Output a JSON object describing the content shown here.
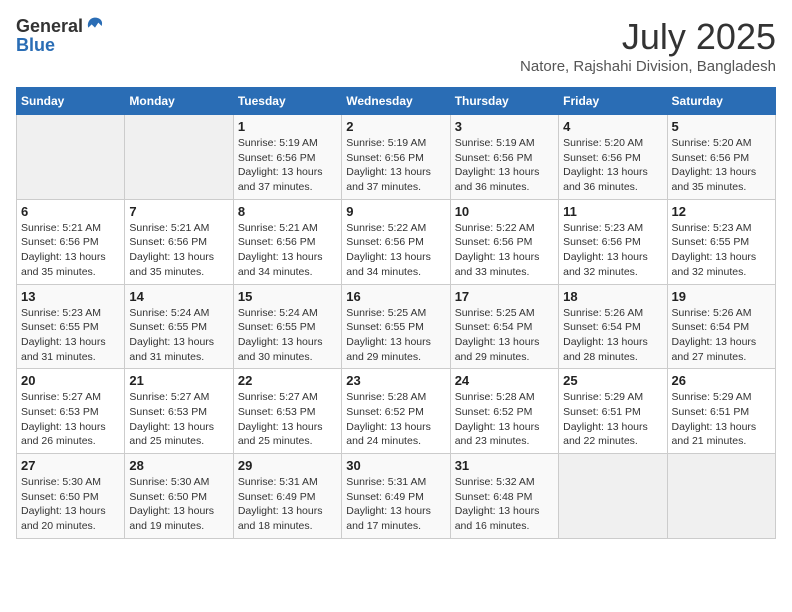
{
  "header": {
    "logo_general": "General",
    "logo_blue": "Blue",
    "title": "July 2025",
    "subtitle": "Natore, Rajshahi Division, Bangladesh"
  },
  "weekdays": [
    "Sunday",
    "Monday",
    "Tuesday",
    "Wednesday",
    "Thursday",
    "Friday",
    "Saturday"
  ],
  "weeks": [
    [
      {
        "day": "",
        "sunrise": "",
        "sunset": "",
        "daylight": ""
      },
      {
        "day": "",
        "sunrise": "",
        "sunset": "",
        "daylight": ""
      },
      {
        "day": "1",
        "sunrise": "Sunrise: 5:19 AM",
        "sunset": "Sunset: 6:56 PM",
        "daylight": "Daylight: 13 hours and 37 minutes."
      },
      {
        "day": "2",
        "sunrise": "Sunrise: 5:19 AM",
        "sunset": "Sunset: 6:56 PM",
        "daylight": "Daylight: 13 hours and 37 minutes."
      },
      {
        "day": "3",
        "sunrise": "Sunrise: 5:19 AM",
        "sunset": "Sunset: 6:56 PM",
        "daylight": "Daylight: 13 hours and 36 minutes."
      },
      {
        "day": "4",
        "sunrise": "Sunrise: 5:20 AM",
        "sunset": "Sunset: 6:56 PM",
        "daylight": "Daylight: 13 hours and 36 minutes."
      },
      {
        "day": "5",
        "sunrise": "Sunrise: 5:20 AM",
        "sunset": "Sunset: 6:56 PM",
        "daylight": "Daylight: 13 hours and 35 minutes."
      }
    ],
    [
      {
        "day": "6",
        "sunrise": "Sunrise: 5:21 AM",
        "sunset": "Sunset: 6:56 PM",
        "daylight": "Daylight: 13 hours and 35 minutes."
      },
      {
        "day": "7",
        "sunrise": "Sunrise: 5:21 AM",
        "sunset": "Sunset: 6:56 PM",
        "daylight": "Daylight: 13 hours and 35 minutes."
      },
      {
        "day": "8",
        "sunrise": "Sunrise: 5:21 AM",
        "sunset": "Sunset: 6:56 PM",
        "daylight": "Daylight: 13 hours and 34 minutes."
      },
      {
        "day": "9",
        "sunrise": "Sunrise: 5:22 AM",
        "sunset": "Sunset: 6:56 PM",
        "daylight": "Daylight: 13 hours and 34 minutes."
      },
      {
        "day": "10",
        "sunrise": "Sunrise: 5:22 AM",
        "sunset": "Sunset: 6:56 PM",
        "daylight": "Daylight: 13 hours and 33 minutes."
      },
      {
        "day": "11",
        "sunrise": "Sunrise: 5:23 AM",
        "sunset": "Sunset: 6:56 PM",
        "daylight": "Daylight: 13 hours and 32 minutes."
      },
      {
        "day": "12",
        "sunrise": "Sunrise: 5:23 AM",
        "sunset": "Sunset: 6:55 PM",
        "daylight": "Daylight: 13 hours and 32 minutes."
      }
    ],
    [
      {
        "day": "13",
        "sunrise": "Sunrise: 5:23 AM",
        "sunset": "Sunset: 6:55 PM",
        "daylight": "Daylight: 13 hours and 31 minutes."
      },
      {
        "day": "14",
        "sunrise": "Sunrise: 5:24 AM",
        "sunset": "Sunset: 6:55 PM",
        "daylight": "Daylight: 13 hours and 31 minutes."
      },
      {
        "day": "15",
        "sunrise": "Sunrise: 5:24 AM",
        "sunset": "Sunset: 6:55 PM",
        "daylight": "Daylight: 13 hours and 30 minutes."
      },
      {
        "day": "16",
        "sunrise": "Sunrise: 5:25 AM",
        "sunset": "Sunset: 6:55 PM",
        "daylight": "Daylight: 13 hours and 29 minutes."
      },
      {
        "day": "17",
        "sunrise": "Sunrise: 5:25 AM",
        "sunset": "Sunset: 6:54 PM",
        "daylight": "Daylight: 13 hours and 29 minutes."
      },
      {
        "day": "18",
        "sunrise": "Sunrise: 5:26 AM",
        "sunset": "Sunset: 6:54 PM",
        "daylight": "Daylight: 13 hours and 28 minutes."
      },
      {
        "day": "19",
        "sunrise": "Sunrise: 5:26 AM",
        "sunset": "Sunset: 6:54 PM",
        "daylight": "Daylight: 13 hours and 27 minutes."
      }
    ],
    [
      {
        "day": "20",
        "sunrise": "Sunrise: 5:27 AM",
        "sunset": "Sunset: 6:53 PM",
        "daylight": "Daylight: 13 hours and 26 minutes."
      },
      {
        "day": "21",
        "sunrise": "Sunrise: 5:27 AM",
        "sunset": "Sunset: 6:53 PM",
        "daylight": "Daylight: 13 hours and 25 minutes."
      },
      {
        "day": "22",
        "sunrise": "Sunrise: 5:27 AM",
        "sunset": "Sunset: 6:53 PM",
        "daylight": "Daylight: 13 hours and 25 minutes."
      },
      {
        "day": "23",
        "sunrise": "Sunrise: 5:28 AM",
        "sunset": "Sunset: 6:52 PM",
        "daylight": "Daylight: 13 hours and 24 minutes."
      },
      {
        "day": "24",
        "sunrise": "Sunrise: 5:28 AM",
        "sunset": "Sunset: 6:52 PM",
        "daylight": "Daylight: 13 hours and 23 minutes."
      },
      {
        "day": "25",
        "sunrise": "Sunrise: 5:29 AM",
        "sunset": "Sunset: 6:51 PM",
        "daylight": "Daylight: 13 hours and 22 minutes."
      },
      {
        "day": "26",
        "sunrise": "Sunrise: 5:29 AM",
        "sunset": "Sunset: 6:51 PM",
        "daylight": "Daylight: 13 hours and 21 minutes."
      }
    ],
    [
      {
        "day": "27",
        "sunrise": "Sunrise: 5:30 AM",
        "sunset": "Sunset: 6:50 PM",
        "daylight": "Daylight: 13 hours and 20 minutes."
      },
      {
        "day": "28",
        "sunrise": "Sunrise: 5:30 AM",
        "sunset": "Sunset: 6:50 PM",
        "daylight": "Daylight: 13 hours and 19 minutes."
      },
      {
        "day": "29",
        "sunrise": "Sunrise: 5:31 AM",
        "sunset": "Sunset: 6:49 PM",
        "daylight": "Daylight: 13 hours and 18 minutes."
      },
      {
        "day": "30",
        "sunrise": "Sunrise: 5:31 AM",
        "sunset": "Sunset: 6:49 PM",
        "daylight": "Daylight: 13 hours and 17 minutes."
      },
      {
        "day": "31",
        "sunrise": "Sunrise: 5:32 AM",
        "sunset": "Sunset: 6:48 PM",
        "daylight": "Daylight: 13 hours and 16 minutes."
      },
      {
        "day": "",
        "sunrise": "",
        "sunset": "",
        "daylight": ""
      },
      {
        "day": "",
        "sunrise": "",
        "sunset": "",
        "daylight": ""
      }
    ]
  ]
}
